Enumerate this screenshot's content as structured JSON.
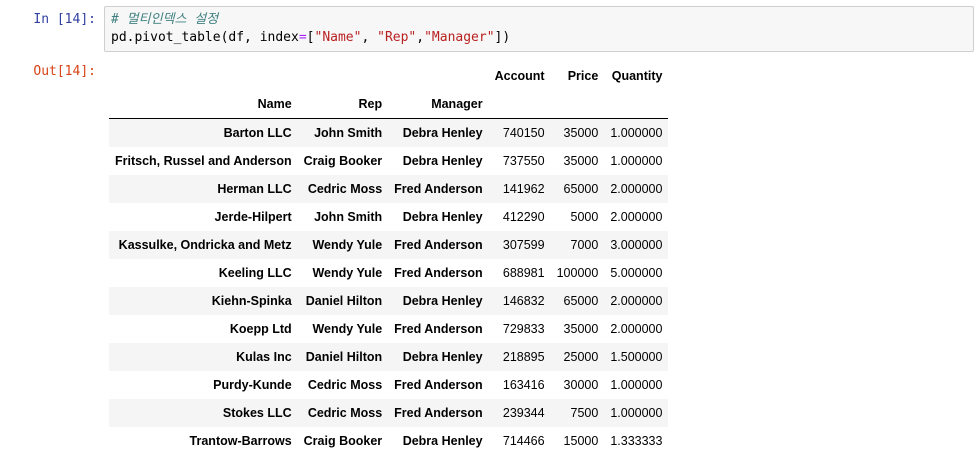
{
  "cells": {
    "in_prompt": "In [14]:",
    "code_comment": "# 멀티인덱스 설정",
    "code_line": {
      "a": "pd.pivot_table(df, index",
      "eq": "=",
      "b": "[",
      "s1": "\"Name\"",
      "c1": ", ",
      "s2": "\"Rep\"",
      "c2": ",",
      "s3": "\"Manager\"",
      "d": "])"
    },
    "out_prompt": "Out[14]:"
  },
  "table": {
    "value_columns": [
      "Account",
      "Price",
      "Quantity"
    ],
    "index_names": [
      "Name",
      "Rep",
      "Manager"
    ],
    "rows": [
      {
        "name": "Barton LLC",
        "rep": "John Smith",
        "manager": "Debra Henley",
        "account": "740150",
        "price": "35000",
        "quantity": "1.000000"
      },
      {
        "name": "Fritsch, Russel and Anderson",
        "rep": "Craig Booker",
        "manager": "Debra Henley",
        "account": "737550",
        "price": "35000",
        "quantity": "1.000000"
      },
      {
        "name": "Herman LLC",
        "rep": "Cedric Moss",
        "manager": "Fred Anderson",
        "account": "141962",
        "price": "65000",
        "quantity": "2.000000"
      },
      {
        "name": "Jerde-Hilpert",
        "rep": "John Smith",
        "manager": "Debra Henley",
        "account": "412290",
        "price": "5000",
        "quantity": "2.000000"
      },
      {
        "name": "Kassulke, Ondricka and Metz",
        "rep": "Wendy Yule",
        "manager": "Fred Anderson",
        "account": "307599",
        "price": "7000",
        "quantity": "3.000000"
      },
      {
        "name": "Keeling LLC",
        "rep": "Wendy Yule",
        "manager": "Fred Anderson",
        "account": "688981",
        "price": "100000",
        "quantity": "5.000000"
      },
      {
        "name": "Kiehn-Spinka",
        "rep": "Daniel Hilton",
        "manager": "Debra Henley",
        "account": "146832",
        "price": "65000",
        "quantity": "2.000000"
      },
      {
        "name": "Koepp Ltd",
        "rep": "Wendy Yule",
        "manager": "Fred Anderson",
        "account": "729833",
        "price": "35000",
        "quantity": "2.000000"
      },
      {
        "name": "Kulas Inc",
        "rep": "Daniel Hilton",
        "manager": "Debra Henley",
        "account": "218895",
        "price": "25000",
        "quantity": "1.500000"
      },
      {
        "name": "Purdy-Kunde",
        "rep": "Cedric Moss",
        "manager": "Fred Anderson",
        "account": "163416",
        "price": "30000",
        "quantity": "1.000000"
      },
      {
        "name": "Stokes LLC",
        "rep": "Cedric Moss",
        "manager": "Fred Anderson",
        "account": "239344",
        "price": "7500",
        "quantity": "1.000000"
      },
      {
        "name": "Trantow-Barrows",
        "rep": "Craig Booker",
        "manager": "Debra Henley",
        "account": "714466",
        "price": "15000",
        "quantity": "1.333333"
      }
    ]
  }
}
